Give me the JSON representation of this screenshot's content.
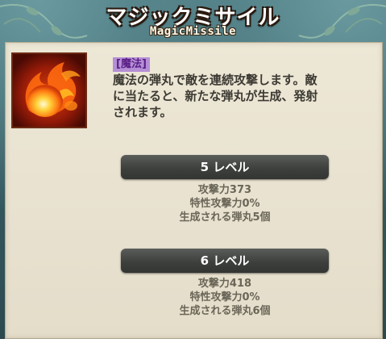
{
  "skill": {
    "title": "マジックミサイル",
    "subtitle": "MagicMissile",
    "icon": "fire-missile-icon",
    "category": "[魔法]",
    "description_lines": [
      "魔法の弾丸で敵を連続攻撃します。敵",
      "に当たると、新たな弾丸が生成、発射",
      "されます。"
    ]
  },
  "levels": [
    {
      "label": "5 レベル",
      "stats": [
        "攻撃力373",
        "特性攻撃力0%",
        "生成される弾丸5個"
      ]
    },
    {
      "label": "6 レベル",
      "stats": [
        "攻撃力418",
        "特性攻撃力0%",
        "生成される弾丸6個"
      ]
    }
  ],
  "colors": {
    "panel_bg": "#ece6d5",
    "category_bg": "#b58fd6",
    "category_text": "#5a1f86",
    "level_bar": "#454744",
    "stat_text": "#6a6658"
  }
}
